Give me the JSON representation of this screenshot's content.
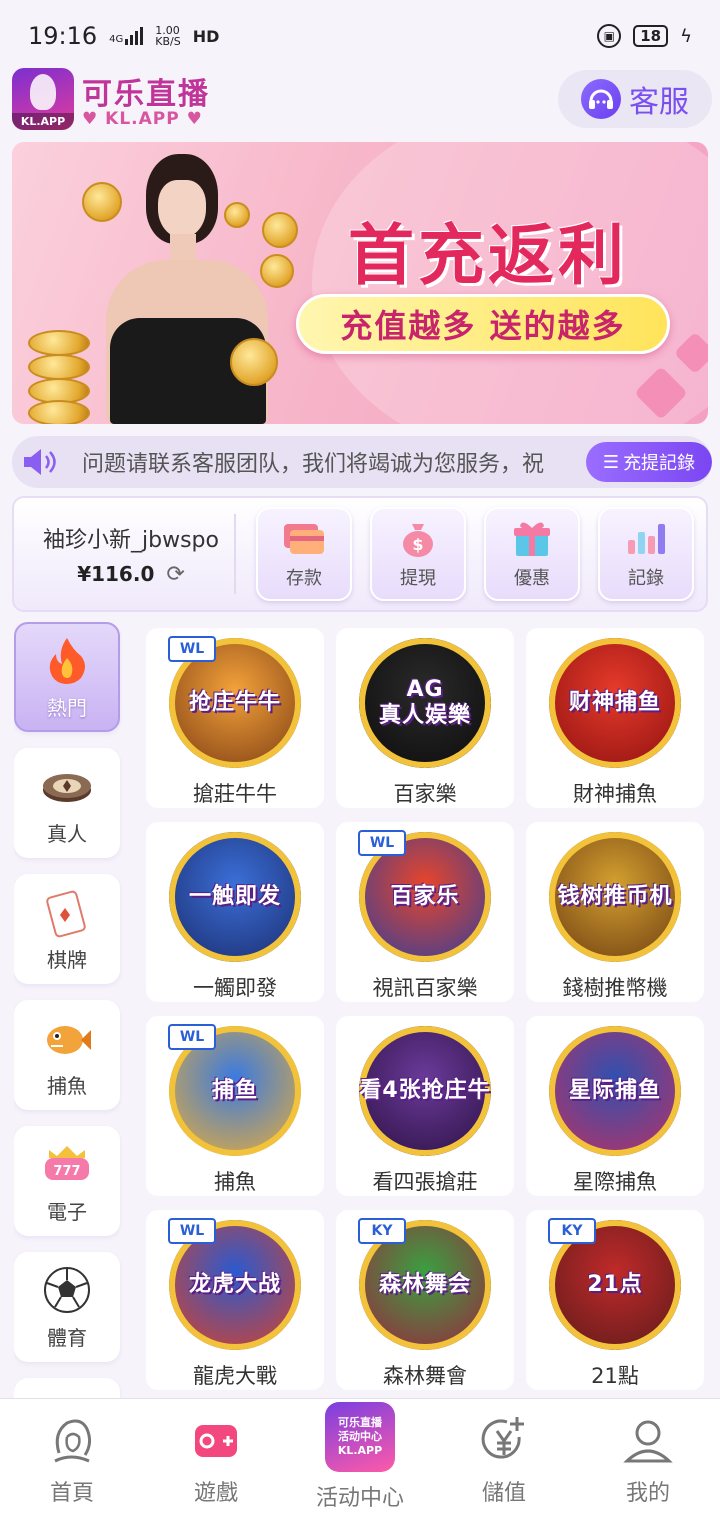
{
  "status": {
    "time": "19:16",
    "network": "4G",
    "speed_value": "1.00",
    "speed_unit": "KB/S",
    "hd": "HD",
    "battery": "18"
  },
  "header": {
    "logo_tag": "KL.APP",
    "brand_name": "可乐直播",
    "brand_sub": "♥ KL.APP ♥",
    "service_label": "客服"
  },
  "banner": {
    "title": "首充返利",
    "slogan": "充值越多  送的越多"
  },
  "marquee": {
    "text": "问题请联系客服团队，我们将竭诚为您服务，祝",
    "record_label": "充提記錄"
  },
  "user": {
    "name": "袖珍小新_jbwspo",
    "balance": "¥116.0"
  },
  "quick_actions": [
    {
      "label": "存款",
      "icon": "card-icon"
    },
    {
      "label": "提現",
      "icon": "money-bag-icon"
    },
    {
      "label": "優惠",
      "icon": "gift-icon"
    },
    {
      "label": "記錄",
      "icon": "bar-chart-icon"
    }
  ],
  "categories": [
    {
      "label": "熱門",
      "icon": "flame-icon",
      "active": true
    },
    {
      "label": "真人",
      "icon": "poker-chip-icon",
      "active": false
    },
    {
      "label": "棋牌",
      "icon": "playing-card-icon",
      "active": false
    },
    {
      "label": "捕魚",
      "icon": "fish-icon",
      "active": false
    },
    {
      "label": "電子",
      "icon": "slot-icon",
      "active": false
    },
    {
      "label": "體育",
      "icon": "soccer-ball-icon",
      "active": false
    }
  ],
  "games": [
    {
      "name": "搶莊牛牛",
      "art_text": "抢庄牛牛",
      "badge": "WL",
      "colors": [
        "#f3a23a",
        "#7a3a12"
      ]
    },
    {
      "name": "百家樂",
      "art_text": "AG\n真人娱樂",
      "badge": "",
      "colors": [
        "#2a2a2a",
        "#0b0b0b"
      ]
    },
    {
      "name": "財神捕魚",
      "art_text": "财神捕鱼",
      "badge": "",
      "colors": [
        "#e63a2a",
        "#8b1010"
      ]
    },
    {
      "name": "一觸即發",
      "art_text": "一触即发",
      "badge": "",
      "colors": [
        "#3b6fd8",
        "#1a2a6a"
      ]
    },
    {
      "name": "視訊百家樂",
      "art_text": "百家乐",
      "badge": "WL",
      "colors": [
        "#e8452a",
        "#2a3fa0"
      ]
    },
    {
      "name": "錢樹推幣機",
      "art_text": "钱树推币机",
      "badge": "",
      "colors": [
        "#d4a030",
        "#6a3a10"
      ]
    },
    {
      "name": "捕魚",
      "art_text": "捕鱼",
      "badge": "WL",
      "colors": [
        "#3a7ae0",
        "#f0b030"
      ]
    },
    {
      "name": "看四張搶莊",
      "art_text": "看4张抢庄牛",
      "badge": "",
      "colors": [
        "#6a3a9a",
        "#2a1040"
      ]
    },
    {
      "name": "星際捕魚",
      "art_text": "星际捕鱼",
      "badge": "",
      "colors": [
        "#3050b0",
        "#c03060"
      ]
    },
    {
      "name": "龍虎大戰",
      "art_text": "龙虎大战",
      "badge": "WL",
      "colors": [
        "#2a5ad0",
        "#e04020"
      ]
    },
    {
      "name": "森林舞會",
      "art_text": "森林舞会",
      "badge": "KY",
      "colors": [
        "#3aa040",
        "#a02040"
      ]
    },
    {
      "name": "21點",
      "art_text": "21点",
      "badge": "KY",
      "colors": [
        "#c02a2a",
        "#5a1a1a"
      ]
    }
  ],
  "bottom_nav": [
    {
      "label": "首頁",
      "icon": "lady-face-icon"
    },
    {
      "label": "遊戲",
      "icon": "gamepad-icon"
    },
    {
      "label": "活动中心",
      "icon": "event-center-icon",
      "icon_text": "可乐直播\n活动中心\nKL.APP"
    },
    {
      "label": "儲值",
      "icon": "yen-plus-icon"
    },
    {
      "label": "我的",
      "icon": "profile-icon"
    }
  ]
}
